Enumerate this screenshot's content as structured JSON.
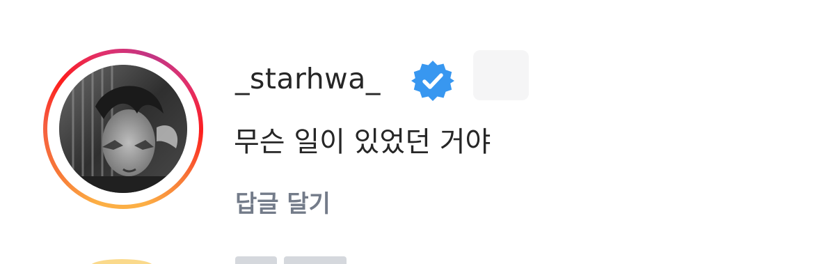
{
  "comment": {
    "username": "_starhwa_",
    "verified": true,
    "text": "무슨 일이 있었던 거야",
    "reply_label": "답글 달기"
  },
  "colors": {
    "verified_badge": "#3897f0",
    "username_text": "#262626",
    "reply_text": "#737b89"
  },
  "icons": {
    "verified": "verified-badge-icon"
  }
}
